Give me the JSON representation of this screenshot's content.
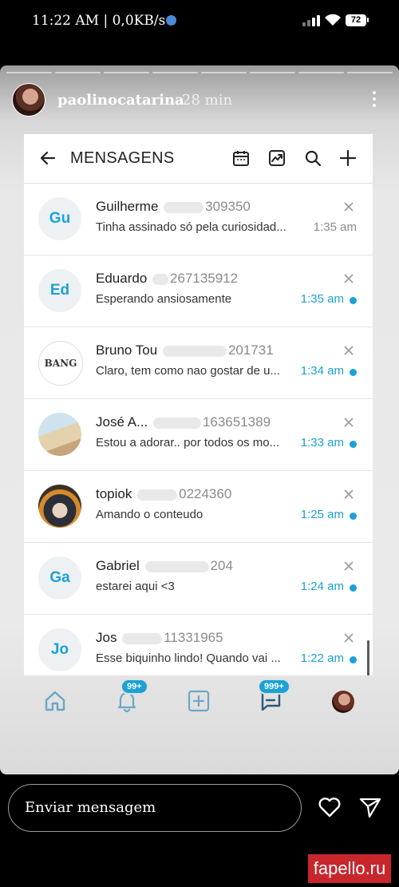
{
  "status_bar": {
    "text": "11:22 AM | 0,0KB/s",
    "battery": "72"
  },
  "story": {
    "username": "paolinocatarina",
    "time": "28 min"
  },
  "app": {
    "title": "MENSAGENS",
    "messages": [
      {
        "initials": "Gu",
        "name": "Guilherme",
        "number": "309350",
        "text": "Tinha assinado só pela curiosidad...",
        "time": "1:35 am",
        "unread": false
      },
      {
        "initials": "Ed",
        "name": "Eduardo",
        "number": "267135912",
        "text": "Esperando ansiosamente",
        "time": "1:35 am",
        "unread": true
      },
      {
        "initials": "",
        "avatar_text": "BANG",
        "name": "Bruno Tou",
        "number": "201731",
        "text": "Claro, tem como nao gostar de u...",
        "time": "1:34 am",
        "unread": true
      },
      {
        "initials": "",
        "name": "José A...",
        "number": "163651389",
        "text": "Estou a adorar.. por todos os mo...",
        "time": "1:33 am",
        "unread": true
      },
      {
        "initials": "",
        "name": "topiok",
        "number": "0224360",
        "text": "Amando o conteudo",
        "time": "1:25 am",
        "unread": true
      },
      {
        "initials": "Ga",
        "name": "Gabriel",
        "number": "204",
        "text": "estarei aqui <3",
        "time": "1:24 am",
        "unread": true
      },
      {
        "initials": "Jo",
        "name": "Jos",
        "number": "11331965",
        "text": "Esse biquinho lindo! Quando vai ...",
        "time": "1:22 am",
        "unread": true
      }
    ],
    "tabs": {
      "notifications_badge": "99+",
      "messages_badge": "999+"
    }
  },
  "reply": {
    "placeholder": "Enviar mensagem"
  },
  "watermark": "fapello.ru"
}
